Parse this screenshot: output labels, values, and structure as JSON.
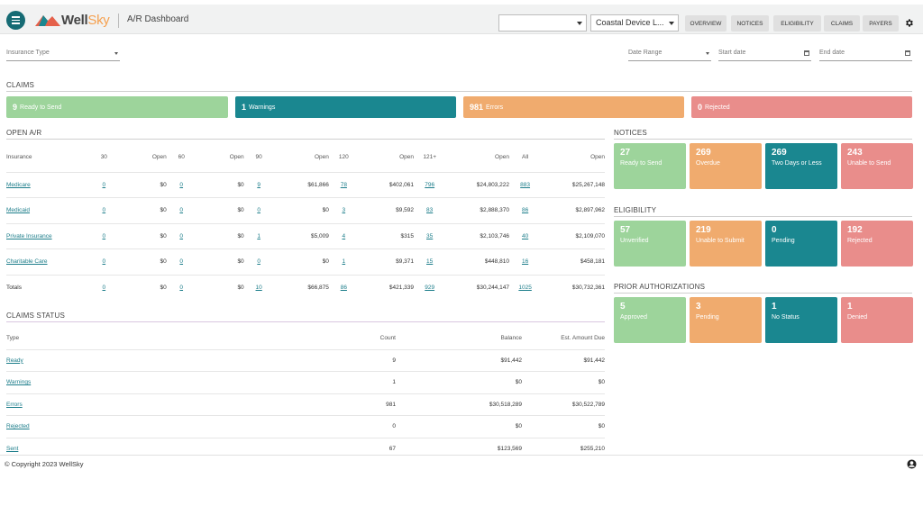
{
  "header": {
    "app_title": "A/R Dashboard",
    "logo_well": "Well",
    "logo_sky": "Sky",
    "empty_select": "",
    "location_select": "Coastal Device L...",
    "nav": [
      "OVERVIEW",
      "NOTICES",
      "ELIGIBILITY",
      "CLAIMS",
      "PAYERS"
    ]
  },
  "filters": {
    "insurance_type": "Insurance Type",
    "date_range": "Date Range",
    "start_date": "Start date",
    "end_date": "End date"
  },
  "claims": {
    "title": "CLAIMS",
    "bars": [
      {
        "count": "9",
        "label": "Ready to Send"
      },
      {
        "count": "1",
        "label": "Warnings"
      },
      {
        "count": "981",
        "label": "Errors"
      },
      {
        "count": "0",
        "label": "Rejected"
      }
    ]
  },
  "open_ar": {
    "title": "OPEN A/R",
    "headers": [
      "Insurance",
      "30",
      "Open",
      "60",
      "Open",
      "90",
      "Open",
      "120",
      "Open",
      "121+",
      "Open",
      "All",
      "Open"
    ],
    "rows": [
      [
        "Medicare",
        "0",
        "$0",
        "0",
        "$0",
        "9",
        "$61,866",
        "78",
        "$402,061",
        "796",
        "$24,803,222",
        "883",
        "$25,267,148"
      ],
      [
        "Medicaid",
        "0",
        "$0",
        "0",
        "$0",
        "0",
        "$0",
        "3",
        "$9,592",
        "83",
        "$2,888,370",
        "86",
        "$2,897,962"
      ],
      [
        "Private Insurance",
        "0",
        "$0",
        "0",
        "$0",
        "1",
        "$5,009",
        "4",
        "$315",
        "35",
        "$2,103,746",
        "40",
        "$2,109,070"
      ],
      [
        "Charitable Care",
        "0",
        "$0",
        "0",
        "$0",
        "0",
        "$0",
        "1",
        "$9,371",
        "15",
        "$448,810",
        "16",
        "$458,181"
      ],
      [
        "Totals",
        "0",
        "$0",
        "0",
        "$0",
        "10",
        "$66,875",
        "86",
        "$421,339",
        "929",
        "$30,244,147",
        "1025",
        "$30,732,361"
      ]
    ]
  },
  "claims_status": {
    "title": "CLAIMS STATUS",
    "headers": [
      "Type",
      "Count",
      "Balance",
      "Est. Amount Due"
    ],
    "rows": [
      [
        "Ready",
        "9",
        "$91,442",
        "$91,442"
      ],
      [
        "Warnings",
        "1",
        "$0",
        "$0"
      ],
      [
        "Errors",
        "981",
        "$30,518,289",
        "$30,522,789"
      ],
      [
        "Rejected",
        "0",
        "$0",
        "$0"
      ],
      [
        "Sent",
        "67",
        "$123,569",
        "$255,210"
      ]
    ]
  },
  "notices": {
    "title": "NOTICES",
    "tiles": [
      {
        "num": "27",
        "label": "Ready to Send"
      },
      {
        "num": "269",
        "label": "Overdue"
      },
      {
        "num": "269",
        "label": "Two Days or Less"
      },
      {
        "num": "243",
        "label": "Unable to Send"
      }
    ]
  },
  "eligibility": {
    "title": "ELIGIBILITY",
    "tiles": [
      {
        "num": "57",
        "label": "Unverified"
      },
      {
        "num": "219",
        "label": "Unable to Submit"
      },
      {
        "num": "0",
        "label": "Pending"
      },
      {
        "num": "192",
        "label": "Rejected"
      }
    ]
  },
  "prior_auth": {
    "title": "PRIOR AUTHORIZATIONS",
    "tiles": [
      {
        "num": "5",
        "label": "Approved"
      },
      {
        "num": "3",
        "label": "Pending"
      },
      {
        "num": "1",
        "label": "No Status"
      },
      {
        "num": "1",
        "label": "Denied"
      }
    ]
  },
  "footer": {
    "copyright": "© Copyright 2023 WellSky"
  },
  "colors": {
    "green": "#9dd49b",
    "teal": "#1a8790",
    "orange": "#f0ab6e",
    "red": "#e98d8b"
  }
}
